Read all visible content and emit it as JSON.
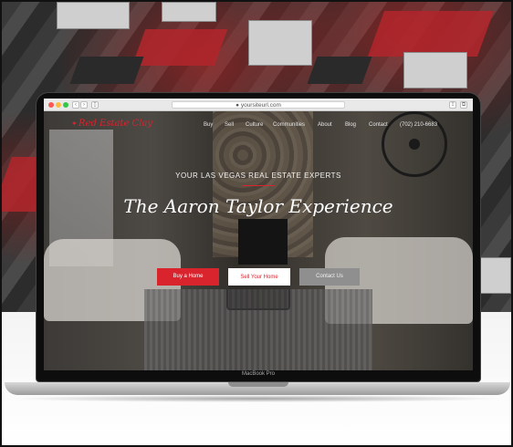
{
  "browser": {
    "url": "yoursiteurl.com"
  },
  "site": {
    "logo": "Red Estate Clay",
    "nav": [
      "Buy",
      "Sell",
      "Culture",
      "Communities",
      "About",
      "Blog",
      "Contact"
    ],
    "phone": "(702) 210-6683",
    "tagline": "YOUR LAS VEGAS REAL ESTATE EXPERTS",
    "title": "The Aaron Taylor Experience",
    "buttons": {
      "buy": "Buy a Home",
      "sell": "Sell Your Home",
      "contact": "Contact Us"
    },
    "accent_color": "#d9232d"
  },
  "device": {
    "label": "MacBook Pro"
  }
}
